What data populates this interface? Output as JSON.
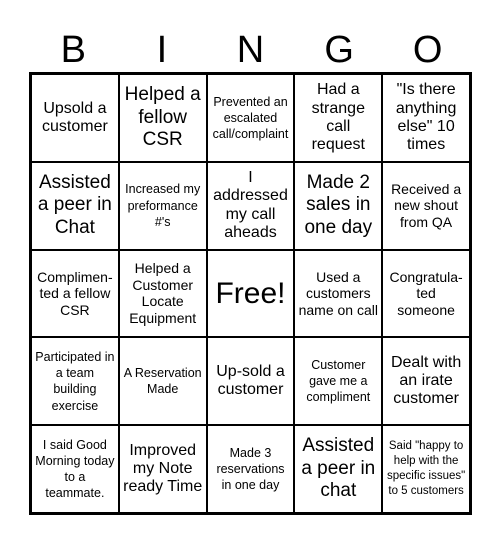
{
  "header": {
    "letters": [
      "B",
      "I",
      "N",
      "G",
      "O"
    ]
  },
  "cells": [
    [
      "Upsold a customer",
      "Helped a fellow CSR",
      "Prevented an escalated call/complaint",
      "Had a strange call request",
      "\"Is there anything else\" 10 times"
    ],
    [
      "Assisted a peer in Chat",
      "Increased my preformance #'s",
      "I addressed my call aheads",
      "Made 2 sales in one day",
      "Received a new shout from QA"
    ],
    [
      "Complimen-ted a fellow CSR",
      "Helped a Customer Locate Equipment",
      "Free!",
      "Used a customers name on call",
      "Congratula-ted someone"
    ],
    [
      "Participated in a team building exercise",
      "A Reservation Made",
      "Up-sold a customer",
      "Customer gave me a compliment",
      "Dealt with an irate customer"
    ],
    [
      "I said Good Morning today to a teammate.",
      "Improved my Note ready Time",
      "Made 3 reservations in one day",
      "Assisted a peer in chat",
      "Said \"happy to help with the specific issues\" to 5 customers"
    ]
  ]
}
